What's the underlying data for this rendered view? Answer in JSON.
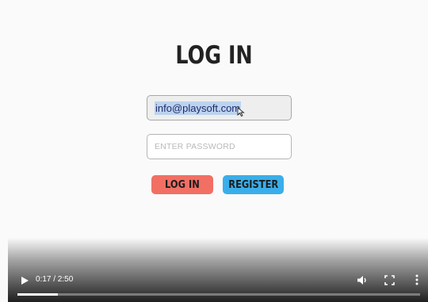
{
  "login_form": {
    "title": "LOG IN",
    "email_value": "info@playsoft.com",
    "password_placeholder": "ENTER PASSWORD",
    "login_button": "LOG IN",
    "register_button": "REGISTER"
  },
  "video_player": {
    "time": "0:17 / 2:50",
    "progress": 0.1,
    "icons": {
      "play": "play-icon",
      "volume": "volume-icon",
      "fullscreen": "fullscreen-icon",
      "more": "more-vertical-icon"
    }
  },
  "colors": {
    "login_button": "#f26f64",
    "register_button": "#3aaeea",
    "selection_highlight": "#bcd3ee"
  }
}
